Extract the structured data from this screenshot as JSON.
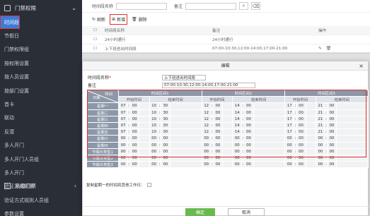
{
  "sidebar": {
    "header": "门禁权限",
    "items": [
      "时间段",
      "节假日",
      "门禁权限组",
      "按权限设置",
      "按人员设置",
      "按部门设置",
      "首卡",
      "联动",
      "反潜",
      "多人开门",
      "多人开门人员组",
      "多人开门",
      "验证方式规则",
      "验证方式规则人员组",
      "参数设置"
    ],
    "footer": "高级门禁"
  },
  "filter": {
    "name_label": "时间段名称",
    "remark_label": "备注"
  },
  "toolbar": {
    "refresh": "刷新",
    "new": "新增",
    "delete": "删除"
  },
  "list": {
    "headers": {
      "name": "时间段名称",
      "remark": "备注",
      "action": "操作"
    },
    "rows": [
      {
        "name": "24小时通行",
        "remark": "24小时通行"
      },
      {
        "name": "上下班进出时间段",
        "remark": "07:00-10:30,12:00-14:00,17:00-21:00"
      }
    ]
  },
  "dialog": {
    "title": "编辑",
    "name_label": "时间段名称",
    "name_required": "*",
    "name_value": "上下班进出时间段",
    "remark_label": "备注",
    "remark_value": "07:00-10:30,12:00-14:00,17:00-21:00",
    "corner_time": "时间",
    "corner_date": "日期",
    "zones": [
      "时间区间1",
      "时间区间2",
      "时间区间3"
    ],
    "start_label": "开始时间",
    "end_label": "结束时间",
    "days": [
      {
        "label": "星期一",
        "t": [
          [
            "07",
            "00",
            "10",
            "30"
          ],
          [
            "12",
            "00",
            "14",
            "00"
          ],
          [
            "17",
            "00",
            "21",
            "00"
          ]
        ]
      },
      {
        "label": "星期二",
        "t": [
          [
            "07",
            "00",
            "10",
            "30"
          ],
          [
            "12",
            "00",
            "14",
            "00"
          ],
          [
            "17",
            "00",
            "21",
            "00"
          ]
        ]
      },
      {
        "label": "星期三",
        "t": [
          [
            "07",
            "00",
            "10",
            "30"
          ],
          [
            "12",
            "00",
            "14",
            "00"
          ],
          [
            "17",
            "00",
            "21",
            "00"
          ]
        ]
      },
      {
        "label": "星期四",
        "t": [
          [
            "07",
            "00",
            "10",
            "30"
          ],
          [
            "12",
            "00",
            "14",
            "00"
          ],
          [
            "17",
            "00",
            "21",
            "00"
          ]
        ]
      },
      {
        "label": "星期五",
        "t": [
          [
            "07",
            "00",
            "10",
            "30"
          ],
          [
            "12",
            "00",
            "14",
            "00"
          ],
          [
            "17",
            "00",
            "21",
            "00"
          ]
        ]
      },
      {
        "label": "星期六",
        "t": [
          [
            "00",
            "00",
            "00",
            "00"
          ],
          [
            "00",
            "00",
            "00",
            "00"
          ],
          [
            "00",
            "00",
            "00",
            "00"
          ]
        ]
      },
      {
        "label": "星期日",
        "t": [
          [
            "00",
            "00",
            "00",
            "00"
          ],
          [
            "00",
            "00",
            "00",
            "00"
          ],
          [
            "00",
            "00",
            "00",
            "00"
          ]
        ]
      },
      {
        "label": "节假日类型1",
        "t": [
          [
            "00",
            "00",
            "00",
            "00"
          ],
          [
            "00",
            "00",
            "00",
            "00"
          ],
          [
            "00",
            "00",
            "00",
            "00"
          ]
        ]
      },
      {
        "label": "节假日类型2",
        "t": [
          [
            "00",
            "00",
            "00",
            "00"
          ],
          [
            "00",
            "00",
            "00",
            "00"
          ],
          [
            "00",
            "00",
            "00",
            "00"
          ]
        ]
      },
      {
        "label": "节假日类型3",
        "t": [
          [
            "00",
            "00",
            "00",
            "00"
          ],
          [
            "00",
            "00",
            "00",
            "00"
          ],
          [
            "00",
            "00",
            "00",
            "00"
          ]
        ]
      }
    ],
    "time_sep": ":",
    "copy_label": "复制星期一的时间到其他工作日：",
    "ok": "确定",
    "cancel": "取消"
  }
}
